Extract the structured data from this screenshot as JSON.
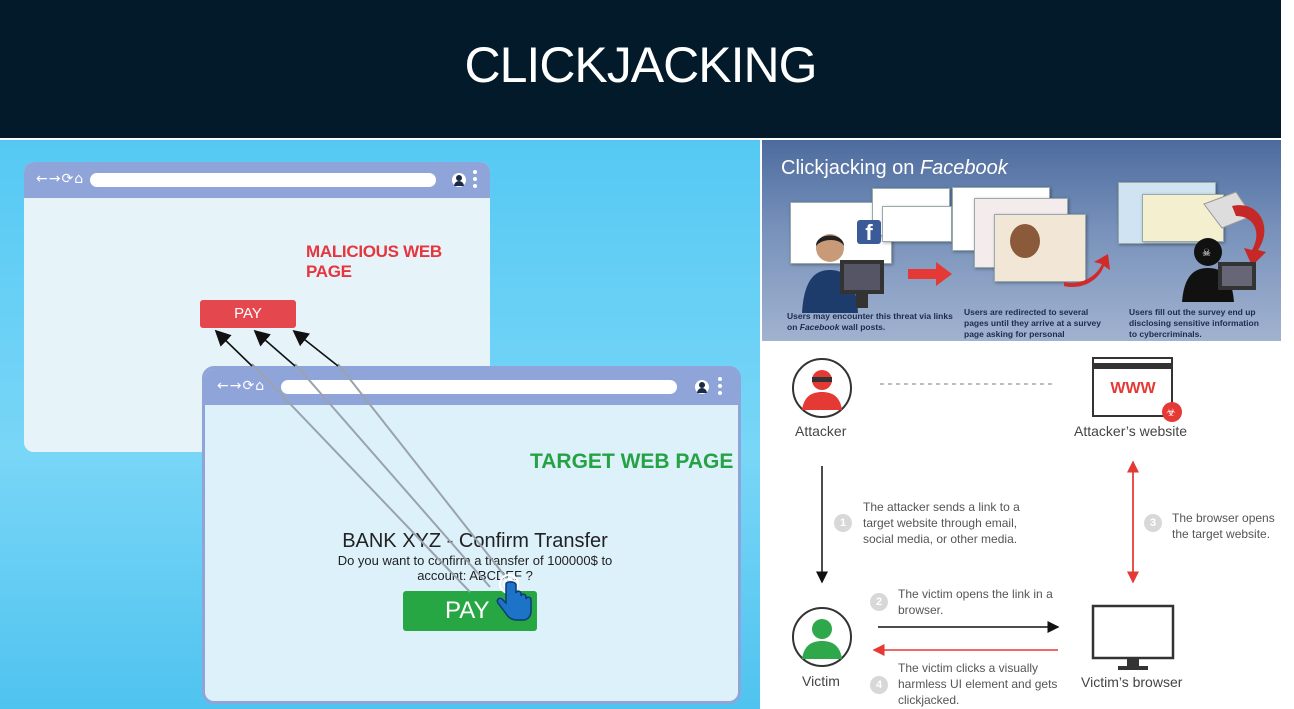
{
  "header": {
    "title": "CLICKJACKING"
  },
  "left_panel": {
    "malicious_window": {
      "nav_icons": "←→⟳⌂",
      "label": "MALICIOUS WEB PAGE",
      "pay_label": "PAY"
    },
    "target_window": {
      "nav_icons": "←→⟳⌂",
      "label": "TARGET WEB PAGE",
      "bank_title": "BANK XYZ - Confirm Transfer",
      "bank_question": "Do you want to confirm a transfer of 100000$ to account: ABCDEF ?",
      "pay_label": "PAY"
    }
  },
  "facebook_panel": {
    "title_prefix": "Clickjacking on ",
    "title_emph": "Facebook",
    "captions": [
      {
        "pre": "Users may encounter this threat via links on ",
        "em": "Facebook",
        "post": " wall posts."
      },
      {
        "pre": "Users are redirected to several pages until they arrive at a survey page asking for personal information.",
        "em": "",
        "post": ""
      },
      {
        "pre": "Users fill out the survey end up disclosing sensitive information to cybercriminals.",
        "em": "",
        "post": ""
      }
    ]
  },
  "flow": {
    "attacker": "Attacker",
    "attacker_site": "Attacker’s website",
    "www": "WWW",
    "victim": "Victim",
    "victim_browser": "Victim’s browser",
    "steps": [
      {
        "num": "1",
        "text": "The attacker sends a link to a target website through email, social media, or other media."
      },
      {
        "num": "2",
        "text": "The victim opens the link in a browser."
      },
      {
        "num": "3",
        "text": "The browser opens the target website."
      },
      {
        "num": "4",
        "text": "The victim clicks a visually harmless UI element and gets clickjacked."
      }
    ]
  },
  "colors": {
    "header_bg": "#031a2b",
    "malicious_red": "#e5363f",
    "target_green": "#25a244",
    "pay_green": "#27a644",
    "flow_red": "#e53935"
  }
}
